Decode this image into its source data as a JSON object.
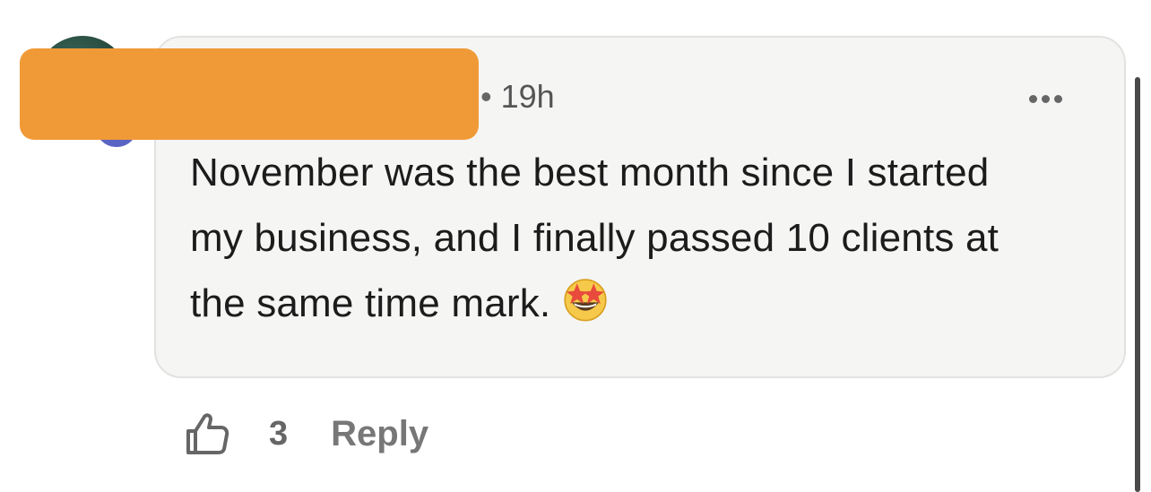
{
  "comment": {
    "author_redacted": true,
    "separator": "•",
    "timestamp": "19h",
    "text_line1": "November was the best month since I started",
    "text_line2": "my business, and I finally passed 10 clients at",
    "text_line3": "the same time mark.",
    "emoji": "star-struck-emoji"
  },
  "actions": {
    "like_icon": "thumbs-up-icon",
    "like_count": "3",
    "reply_label": "Reply"
  },
  "colors": {
    "bubble_bg": "#f5f5f4",
    "redaction": "#f09a37",
    "avatar_badge": "#5a64c4"
  }
}
